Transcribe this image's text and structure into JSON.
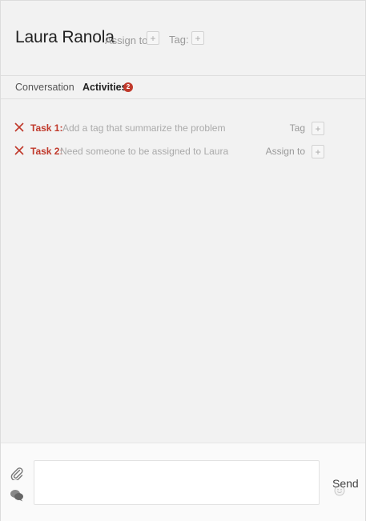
{
  "header": {
    "contact_name": "Laura Ranola",
    "assign_label": "Assign to",
    "assign_plus": "+",
    "tag_label": "Tag:",
    "tag_plus": "+"
  },
  "tabs": [
    {
      "label": "Conversation",
      "active": false
    },
    {
      "label": "Activities",
      "active": true,
      "badge": "2"
    }
  ],
  "tasks": [
    {
      "label": "Task 1:",
      "text": "Add a tag that summarize the problem",
      "action": "Tag",
      "action_plus": "+"
    },
    {
      "label": "Task 2:",
      "text": "Need someone to be assigned to Laura",
      "action": "Assign to",
      "action_plus": "+"
    }
  ],
  "composer": {
    "message_value": "",
    "send_label": "Send",
    "icons": [
      "paperclip-icon",
      "chat-bubbles-icon",
      "emoji-icon"
    ]
  },
  "colors": {
    "accent": "#c0392b",
    "background": "#f2f2f2",
    "muted_text": "#aaaaaa"
  }
}
